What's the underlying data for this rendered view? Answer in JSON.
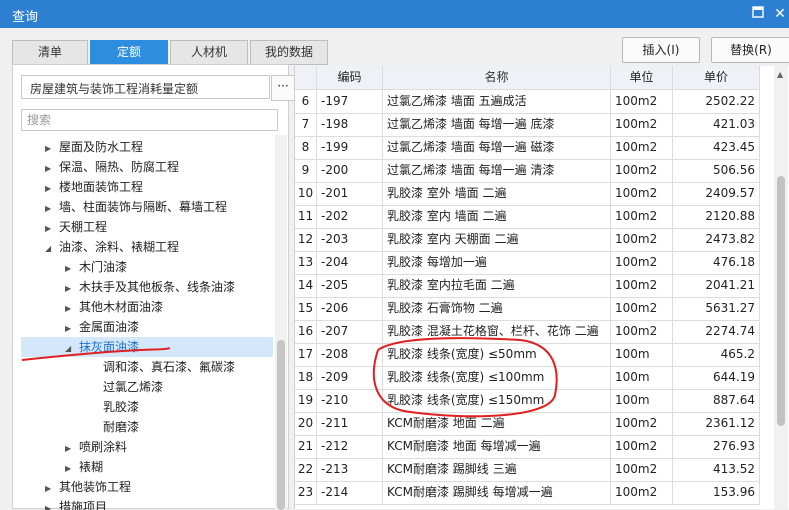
{
  "window": {
    "title": "查询",
    "pin_icon": "pin-icon",
    "close_icon": "close-icon"
  },
  "tabs": [
    {
      "label": "清单",
      "active": false
    },
    {
      "label": "定额",
      "active": true
    },
    {
      "label": "人材机",
      "active": false
    },
    {
      "label": "我的数据",
      "active": false
    }
  ],
  "actions": {
    "insert": "插入(I)",
    "replace": "替换(R)"
  },
  "library": {
    "selected": "房屋建筑与装饰工程消耗量定额",
    "more": "···"
  },
  "search": {
    "placeholder": "搜索"
  },
  "tree": [
    {
      "label": "屋面及防水工程",
      "level": 1,
      "expanded": false
    },
    {
      "label": "保温、隔热、防腐工程",
      "level": 1,
      "expanded": false
    },
    {
      "label": "楼地面装饰工程",
      "level": 1,
      "expanded": false
    },
    {
      "label": "墙、柱面装饰与隔断、幕墙工程",
      "level": 1,
      "expanded": false
    },
    {
      "label": "天棚工程",
      "level": 1,
      "expanded": false
    },
    {
      "label": "油漆、涂料、裱糊工程",
      "level": 1,
      "expanded": true
    },
    {
      "label": "木门油漆",
      "level": 2,
      "expanded": false
    },
    {
      "label": "木扶手及其他板条、线条油漆",
      "level": 2,
      "expanded": false
    },
    {
      "label": "其他木材面油漆",
      "level": 2,
      "expanded": false
    },
    {
      "label": "金属面油漆",
      "level": 2,
      "expanded": false
    },
    {
      "label": "抹灰面油漆",
      "level": 2,
      "expanded": true,
      "selected": true
    },
    {
      "label": "调和漆、真石漆、氟碳漆",
      "level": 3
    },
    {
      "label": "过氯乙烯漆",
      "level": 3
    },
    {
      "label": "乳胶漆",
      "level": 3
    },
    {
      "label": "耐磨漆",
      "level": 3
    },
    {
      "label": "喷刷涂料",
      "level": 2,
      "expanded": false
    },
    {
      "label": "裱糊",
      "level": 2,
      "expanded": false
    },
    {
      "label": "其他装饰工程",
      "level": 1,
      "expanded": false
    },
    {
      "label": "措施项目",
      "level": 1,
      "expanded": false
    }
  ],
  "table": {
    "headers": {
      "code": "编码",
      "name": "名称",
      "unit": "单位",
      "price": "单价"
    },
    "rows": [
      {
        "num": "6",
        "code": "-197",
        "name": "过氯乙烯漆 墙面 五遍成活",
        "unit": "100m2",
        "price": "2502.22"
      },
      {
        "num": "7",
        "code": "-198",
        "name": "过氯乙烯漆 墙面 每增一遍 底漆",
        "unit": "100m2",
        "price": "421.03"
      },
      {
        "num": "8",
        "code": "-199",
        "name": "过氯乙烯漆 墙面 每增一遍 磁漆",
        "unit": "100m2",
        "price": "423.45"
      },
      {
        "num": "9",
        "code": "-200",
        "name": "过氯乙烯漆 墙面 每增一遍 清漆",
        "unit": "100m2",
        "price": "506.56"
      },
      {
        "num": "10",
        "code": "-201",
        "name": "乳胶漆 室外 墙面 二遍",
        "unit": "100m2",
        "price": "2409.57"
      },
      {
        "num": "11",
        "code": "-202",
        "name": "乳胶漆 室内 墙面 二遍",
        "unit": "100m2",
        "price": "2120.88"
      },
      {
        "num": "12",
        "code": "-203",
        "name": "乳胶漆 室内 天棚面 二遍",
        "unit": "100m2",
        "price": "2473.82"
      },
      {
        "num": "13",
        "code": "-204",
        "name": "乳胶漆 每增加一遍",
        "unit": "100m2",
        "price": "476.18"
      },
      {
        "num": "14",
        "code": "-205",
        "name": "乳胶漆 室内拉毛面 二遍",
        "unit": "100m2",
        "price": "2041.21"
      },
      {
        "num": "15",
        "code": "-206",
        "name": "乳胶漆 石膏饰物 二遍",
        "unit": "100m2",
        "price": "5631.27"
      },
      {
        "num": "16",
        "code": "-207",
        "name": "乳胶漆 混凝土花格窗、栏杆、花饰 二遍",
        "unit": "100m2",
        "price": "2274.74"
      },
      {
        "num": "17",
        "code": "-208",
        "name": "乳胶漆 线条(宽度) ≤50mm",
        "unit": "100m",
        "price": "465.2"
      },
      {
        "num": "18",
        "code": "-209",
        "name": "乳胶漆 线条(宽度) ≤100mm",
        "unit": "100m",
        "price": "644.19"
      },
      {
        "num": "19",
        "code": "-210",
        "name": "乳胶漆 线条(宽度) ≤150mm",
        "unit": "100m",
        "price": "887.64"
      },
      {
        "num": "20",
        "code": "-211",
        "name": "KCM耐磨漆 地面 二遍",
        "unit": "100m2",
        "price": "2361.12"
      },
      {
        "num": "21",
        "code": "-212",
        "name": "KCM耐磨漆 地面 每增减一遍",
        "unit": "100m2",
        "price": "276.93"
      },
      {
        "num": "22",
        "code": "-213",
        "name": "KCM耐磨漆 踢脚线 三遍",
        "unit": "100m2",
        "price": "413.52"
      },
      {
        "num": "23",
        "code": "-214",
        "name": "KCM耐磨漆 踢脚线 每增减一遍",
        "unit": "100m2",
        "price": "153.96"
      }
    ]
  },
  "colors": {
    "titlebar": "#2d7fd1",
    "tab_active": "#2d8ee0",
    "annotation": "#e02020"
  }
}
